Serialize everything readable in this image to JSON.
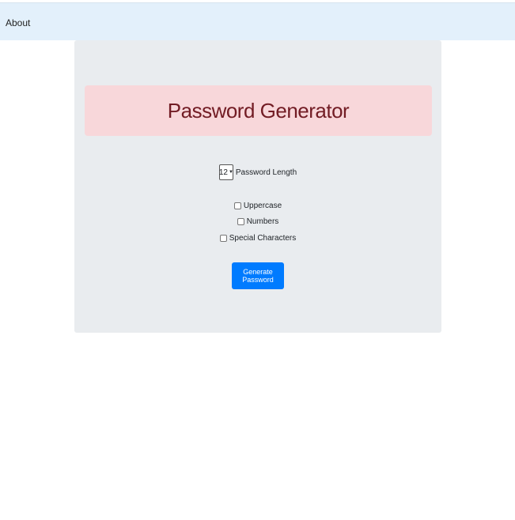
{
  "nav": {
    "about_label": "About"
  },
  "header": {
    "title": "Password Generator"
  },
  "form": {
    "length_value": "12",
    "length_label": "Password Length",
    "options": [
      {
        "label": "Uppercase",
        "checked": false
      },
      {
        "label": "Numbers",
        "checked": false
      },
      {
        "label": "Special Characters",
        "checked": false
      }
    ],
    "generate_label": "Generate Password"
  },
  "colors": {
    "navbar_bg": "#e3f0fb",
    "card_bg": "#e9ecef",
    "banner_bg": "#f8d7da",
    "banner_text": "#721c24",
    "button_bg": "#007bff"
  }
}
